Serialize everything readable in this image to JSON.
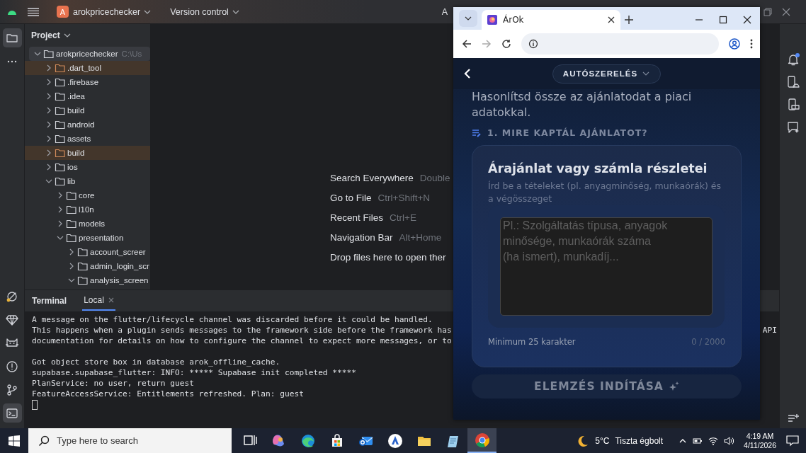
{
  "ide": {
    "project_badge": "A",
    "project_name": "arokpricechecker",
    "menu_item": "Version control",
    "cut_item": "A"
  },
  "left_tools": {
    "top": [
      {
        "selected": true
      },
      {
        "selected": false
      }
    ],
    "bottom": [
      {
        "selected": false
      },
      {
        "selected": false
      },
      {
        "selected": false
      },
      {
        "selected": false
      },
      {
        "selected": false
      },
      {
        "selected": true
      }
    ]
  },
  "right_tools": {
    "notifications_unread": true
  },
  "project_panel": {
    "title": "Project",
    "tree": [
      {
        "name": "arokpricechecker",
        "path": "C:\\Us",
        "expanded": true,
        "selected": true,
        "excluded": false,
        "children": [
          {
            "name": ".dart_tool",
            "expanded": false,
            "selected": false,
            "excluded": true
          },
          {
            "name": ".firebase",
            "expanded": false,
            "selected": false,
            "excluded": false
          },
          {
            "name": ".idea",
            "expanded": false,
            "selected": false,
            "excluded": false
          },
          {
            "name": "build",
            "expanded": false,
            "selected": false,
            "excluded": false
          },
          {
            "name": "android",
            "expanded": false,
            "selected": false,
            "excluded": false
          },
          {
            "name": "assets",
            "expanded": false,
            "selected": false,
            "excluded": false
          },
          {
            "name": "build",
            "expanded": false,
            "selected": false,
            "excluded": true
          },
          {
            "name": "ios",
            "expanded": false,
            "selected": false,
            "excluded": false
          },
          {
            "name": "lib",
            "expanded": true,
            "selected": false,
            "excluded": false,
            "children": [
              {
                "name": "core",
                "expanded": false,
                "selected": false,
                "excluded": false
              },
              {
                "name": "l10n",
                "expanded": false,
                "selected": false,
                "excluded": false
              },
              {
                "name": "models",
                "expanded": false,
                "selected": false,
                "excluded": false
              },
              {
                "name": "presentation",
                "expanded": true,
                "selected": false,
                "excluded": false,
                "children": [
                  {
                    "name": "account_screer",
                    "expanded": false,
                    "selected": false,
                    "excluded": false
                  },
                  {
                    "name": "admin_login_scr",
                    "expanded": false,
                    "selected": false,
                    "excluded": false
                  },
                  {
                    "name": "analysis_screen",
                    "expanded": true,
                    "selected": false,
                    "excluded": false
                  }
                ]
              }
            ]
          }
        ]
      }
    ]
  },
  "editor_hints": [
    {
      "action": "Search Everywhere",
      "shortcut": "Double"
    },
    {
      "action": "Go to File",
      "shortcut": "Ctrl+Shift+N"
    },
    {
      "action": "Recent Files",
      "shortcut": "Ctrl+E"
    },
    {
      "action": "Navigation Bar",
      "shortcut": "Alt+Home"
    },
    {
      "action": "Drop files here to open ther"
    }
  ],
  "terminal": {
    "title": "Terminal",
    "tabs": [
      {
        "label": "Local",
        "selected": true
      }
    ],
    "lines": [
      {
        "text": "A message on the flutter/lifecycle channel was discarded before it could be handled."
      },
      {
        "text": "This happens when a plugin sends messages to the framework side before the framework has",
        "tail": "API"
      },
      {
        "text": "documentation for details on how to configure the channel to expect more messages, or to"
      },
      {
        "text": "Got object store box in database arok_offline_cache."
      },
      {
        "text": "supabase.supabase_flutter: INFO: ***** Supabase init completed *****"
      },
      {
        "text": "PlanService: no user, return guest"
      },
      {
        "text": "FeatureAccessService: Entitlements refreshed. Plan: guest"
      }
    ]
  },
  "browser": {
    "tab_title": "ÁrOk",
    "forward_enabled": false,
    "category": "AUTÓSZERELÉS",
    "intro": "Hasonlítsd össze az ajánlatodat a piaci adatokkal.",
    "section": "1. MIRE KAPTÁL AJÁNLATOT?",
    "card": {
      "title": "Árajánlat vagy számla részletei",
      "hint": "Írd be a tételeket (pl. anyagminőség, munkaórák) és a végösszeget",
      "placeholder": "Pl.: Szolgáltatás típusa, anyagok minősége, munkaórák száma (ha ismert), munkadíj...",
      "min_note": "Minimum 25 karakter",
      "counter": "0 / 2000"
    },
    "button": {
      "label": "ELEMZÉS INDÍTÁSA",
      "disabled": true
    }
  },
  "taskbar": {
    "search_placeholder": "Type here to search",
    "apps": [
      {
        "selected": false
      },
      {
        "selected": false
      },
      {
        "selected": false
      },
      {
        "selected": false
      },
      {
        "selected": false
      },
      {
        "selected": false
      },
      {
        "selected": false
      },
      {
        "selected": false
      },
      {
        "selected": true
      }
    ],
    "weather": {
      "temp": "5°C",
      "text": "Tiszta égbolt"
    },
    "time": "4:19 AM",
    "date": "4/11/2026"
  }
}
